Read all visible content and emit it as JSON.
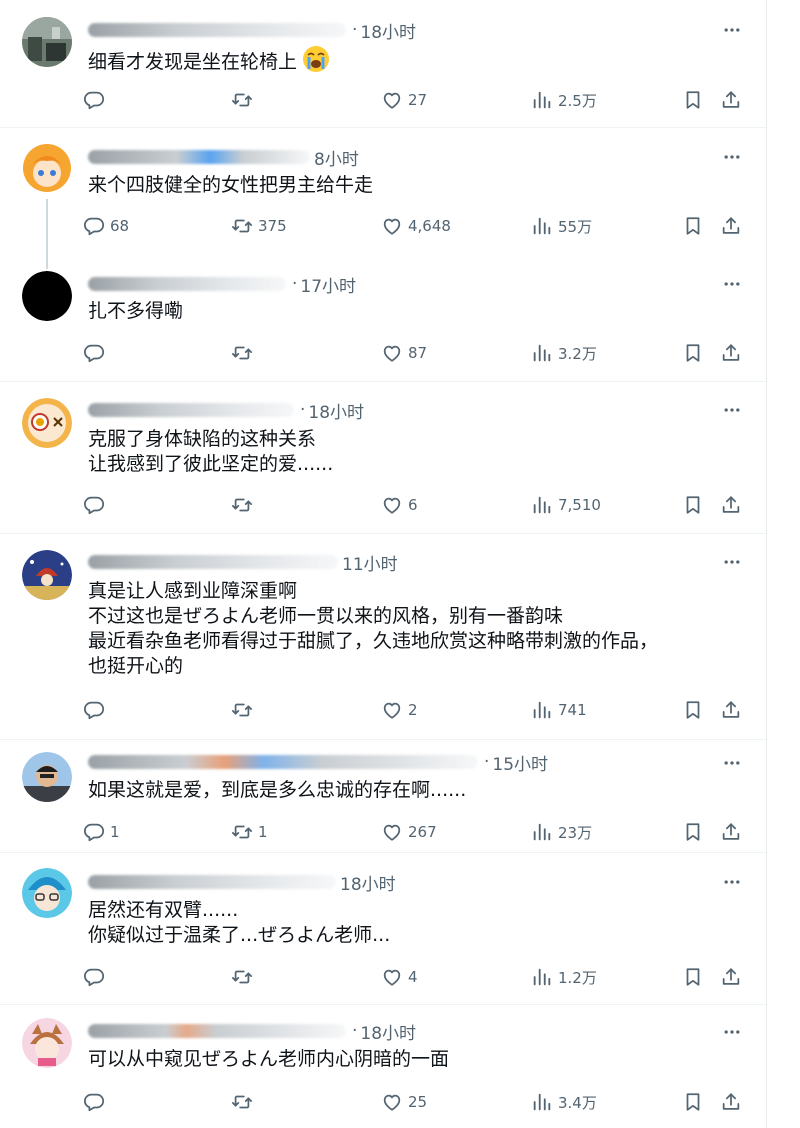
{
  "replies": [
    {
      "time": "18小时",
      "lines": [
        "细看才发现是坐在轮椅上"
      ],
      "emoji": "loudly-crying-face-emoji",
      "counts": {
        "reply": "",
        "retweet": "",
        "like": "27",
        "views": "2.5万"
      }
    },
    {
      "time": "8小时",
      "lines": [
        "来个四肢健全的女性把男主给牛走"
      ],
      "counts": {
        "reply": "68",
        "retweet": "375",
        "like": "4,648",
        "views": "55万"
      }
    },
    {
      "time": "17小时",
      "lines": [
        "扎不多得嘞"
      ],
      "counts": {
        "reply": "",
        "retweet": "",
        "like": "87",
        "views": "3.2万"
      }
    },
    {
      "time": "18小时",
      "lines": [
        "克服了身体缺陷的这种关系",
        "让我感到了彼此坚定的爱......"
      ],
      "counts": {
        "reply": "",
        "retweet": "",
        "like": "6",
        "views": "7,510"
      }
    },
    {
      "time": "11小时",
      "lines": [
        "真是让人感到业障深重啊",
        "不过这也是ぜろよん老师一贯以来的风格，别有一番韵味",
        "最近看杂鱼老师看得过于甜腻了，久违地欣赏这种略带刺激的作品，",
        "也挺开心的"
      ],
      "counts": {
        "reply": "",
        "retweet": "",
        "like": "2",
        "views": "741"
      }
    },
    {
      "time": "15小时",
      "lines": [
        "如果这就是爱，到底是多么忠诚的存在啊......"
      ],
      "counts": {
        "reply": "1",
        "retweet": "1",
        "like": "267",
        "views": "23万"
      }
    },
    {
      "time": "18小时",
      "lines": [
        "居然还有双臂......",
        "你疑似过于温柔了...ぜろよん老师..."
      ],
      "counts": {
        "reply": "",
        "retweet": "",
        "like": "4",
        "views": "1.2万"
      }
    },
    {
      "time": "18小时",
      "lines": [
        "可以从中窥见ぜろよん老师内心阴暗的一面"
      ],
      "counts": {
        "reply": "",
        "retweet": "",
        "like": "25",
        "views": "3.4万"
      }
    }
  ]
}
